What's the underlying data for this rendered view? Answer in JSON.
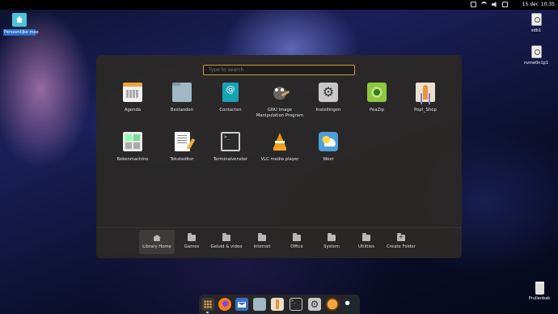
{
  "topbar": {
    "date": "15 dec",
    "time": "10:35",
    "tray_icons": [
      "network-icon",
      "wifi-icon",
      "volume-icon",
      "battery-icon"
    ]
  },
  "desktop": {
    "home_folder_label": "Persoonlijke map",
    "drive1_label": "sdb1",
    "drive2_label": "nvme0n1p1",
    "trash_label": "Prullenbak"
  },
  "launcher": {
    "search_placeholder": "Type to search",
    "apps": [
      {
        "label": "Agenda",
        "icon": "calendar-icon"
      },
      {
        "label": "Bestanden",
        "icon": "files-icon"
      },
      {
        "label": "Contacten",
        "icon": "contacts-icon"
      },
      {
        "label": "GNU Image Manipulation Program",
        "icon": "gimp-icon"
      },
      {
        "label": "Instellingen",
        "icon": "settings-icon"
      },
      {
        "label": "PeaZip",
        "icon": "peazip-icon"
      },
      {
        "label": "Pop!_Shop",
        "icon": "pop-shop-icon"
      },
      {
        "label": "Rekenmachine",
        "icon": "calculator-icon"
      },
      {
        "label": "Teksteditor",
        "icon": "text-editor-icon"
      },
      {
        "label": "Terminalvenster",
        "icon": "terminal-icon"
      },
      {
        "label": "VLC media player",
        "icon": "vlc-icon"
      },
      {
        "label": "Weer",
        "icon": "weather-icon"
      }
    ],
    "folders": [
      {
        "label": "Library Home",
        "active": true
      },
      {
        "label": "Games"
      },
      {
        "label": "Geluid & video"
      },
      {
        "label": "Internet"
      },
      {
        "label": "Office"
      },
      {
        "label": "System"
      },
      {
        "label": "Utilities"
      },
      {
        "label": "Create Folder"
      }
    ]
  },
  "dock": {
    "items": [
      "applications-icon",
      "firefox-icon",
      "mail-icon",
      "files-icon",
      "pop-shop-icon",
      "terminal-icon",
      "settings-icon",
      "app-icon",
      "steam-icon"
    ]
  }
}
